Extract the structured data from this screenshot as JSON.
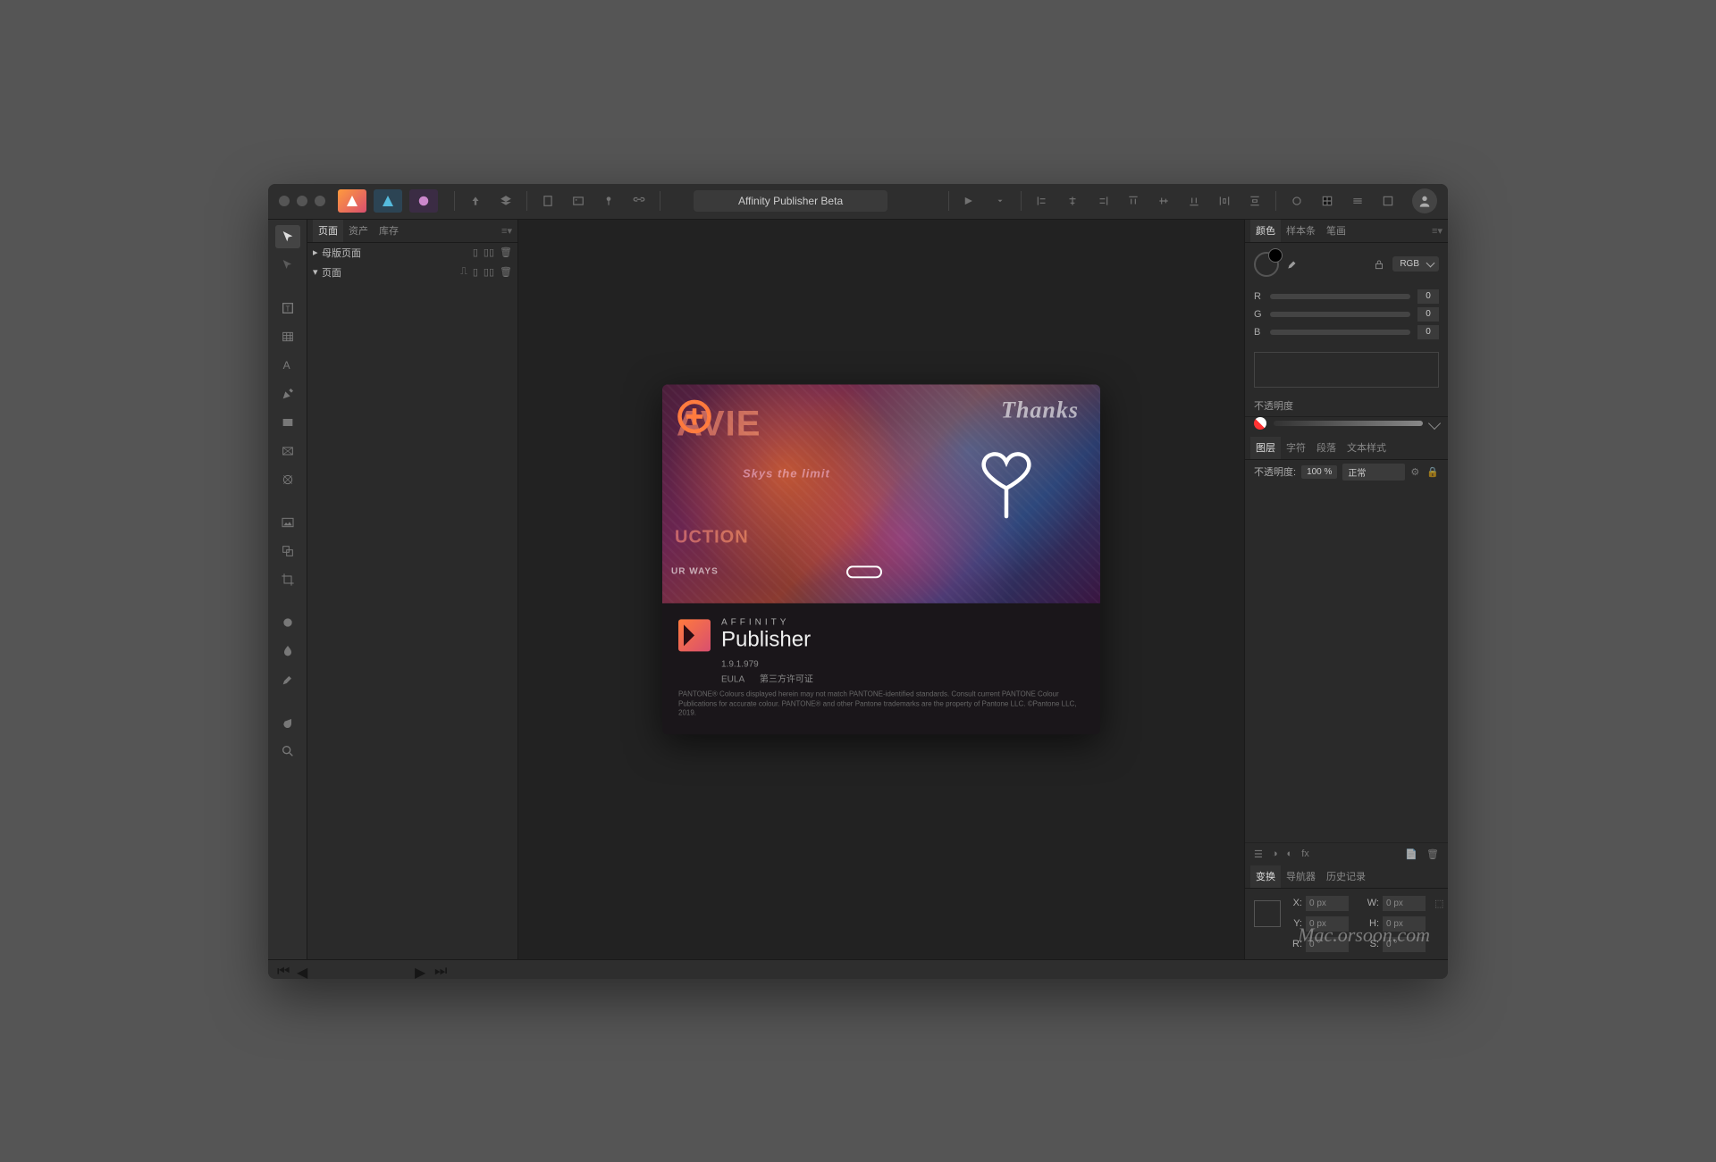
{
  "app_title": "Affinity Publisher Beta",
  "personas": [
    {
      "name": "publisher",
      "bg": "#ff7a3d"
    },
    {
      "name": "designer",
      "bg": "#24b0d4"
    },
    {
      "name": "photo",
      "bg": "#b84fc9"
    }
  ],
  "left_tabs": [
    "页面",
    "资产",
    "库存"
  ],
  "left_active_tab": 0,
  "tree": {
    "master_label": "母版页面",
    "pages_label": "页面"
  },
  "splash": {
    "brand_small": "AFFINITY",
    "brand_big": "Publisher",
    "version": "1.9.1.979",
    "links": [
      "EULA",
      "第三方许可证"
    ],
    "legal": "PANTONE® Colours displayed herein may not match PANTONE-identified standards. Consult current PANTONE Colour Publications for accurate colour. PANTONE® and other Pantone trademarks are the property of Pantone LLC. ©Pantone LLC, 2019.",
    "collage": [
      "AVIE",
      "Thanks",
      "Skys the limit",
      "UCTION",
      "UR WAYS"
    ]
  },
  "color_panel": {
    "tabs": [
      "颜色",
      "样本条",
      "笔画"
    ],
    "active": 0,
    "mode": "RGB",
    "channels": [
      {
        "l": "R",
        "v": "0"
      },
      {
        "l": "G",
        "v": "0"
      },
      {
        "l": "B",
        "v": "0"
      }
    ],
    "opacity_label": "不透明度"
  },
  "layer_panel": {
    "tabs": [
      "图层",
      "字符",
      "段落",
      "文本样式"
    ],
    "active": 0,
    "opacity_label": "不透明度:",
    "opacity_value": "100 %",
    "blend_mode": "正常"
  },
  "nav_tabs": [
    "变换",
    "导航器",
    "历史记录"
  ],
  "nav_active": 0,
  "transform": {
    "X": {
      "l": "X:",
      "v": "0 px"
    },
    "Y": {
      "l": "Y:",
      "v": "0 px"
    },
    "W": {
      "l": "W:",
      "v": "0 px"
    },
    "H": {
      "l": "H:",
      "v": "0 px"
    },
    "R": {
      "l": "R:",
      "v": "0 °"
    },
    "S": {
      "l": "S:",
      "v": "0 °"
    }
  },
  "watermark": "Mac.orsoon.com"
}
